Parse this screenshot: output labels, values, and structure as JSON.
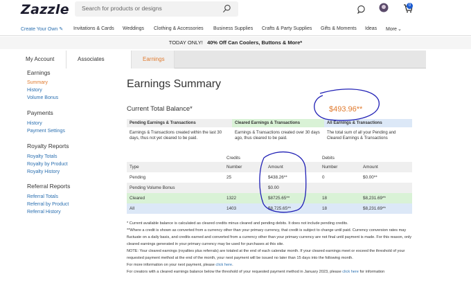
{
  "header": {
    "logo": "Zazzle",
    "search_placeholder": "Search for products or designs",
    "cart_count": "0"
  },
  "nav": {
    "items": [
      "Create Your Own",
      "Invitations & Cards",
      "Weddings",
      "Clothing & Accessories",
      "Business Supplies",
      "Crafts & Party Supplies",
      "Gifts & Moments",
      "Ideas",
      "More"
    ]
  },
  "promo": {
    "prefix": "TODAY ONLY!",
    "text": "40% Off Can Coolers, Buttons & More*"
  },
  "tabs": [
    "My Account",
    "Associates",
    "Earnings"
  ],
  "sidebar": {
    "sections": [
      {
        "title": "Earnings",
        "links": [
          "Summary",
          "History",
          "Volume Bonus"
        ]
      },
      {
        "title": "Payments",
        "links": [
          "History",
          "Payment Settings"
        ]
      },
      {
        "title": "Royalty Reports",
        "links": [
          "Royalty Totals",
          "Royalty by Product",
          "Royalty History"
        ]
      },
      {
        "title": "Referral Reports",
        "links": [
          "Referral Totals",
          "Referral by Product",
          "Referral History"
        ]
      }
    ]
  },
  "main": {
    "title": "Earnings Summary",
    "balance_label": "Current Total Balance*",
    "balance_value": "$493.96**",
    "descriptions": [
      {
        "head": "Pending Earnings & Transactions",
        "body": "Earnings & Transactions created within the last 30 days, thus not yet cleared to be paid."
      },
      {
        "head": "Cleared Earnings & Transactions",
        "body": "Earnings & Transactions created over 30 days ago, thus cleared to be paid."
      },
      {
        "head": "All Earnings & Transactions",
        "body": "The total sum of all your Pending and Cleared Earnings & Transactions"
      }
    ],
    "table": {
      "group_credits": "Credits",
      "group_debits": "Debits",
      "headers": [
        "Type",
        "Number",
        "Amount",
        "Number",
        "Amount"
      ],
      "rows": [
        [
          "Pending",
          "25",
          "$438.26**",
          "0",
          "$0.00**"
        ],
        [
          "Pending Volume Bonus",
          "",
          "$0.00",
          "",
          ""
        ],
        [
          "Cleared",
          "1322",
          "$8725.65**",
          "18",
          "$8,231.69**"
        ],
        [
          "All",
          "1403",
          "$8,725.65**",
          "18",
          "$8,231.69**"
        ]
      ]
    },
    "notes": {
      "n1": "* Current available balance is calculated as cleared credits minus cleared and pending debits. It does not include pending credits.",
      "n2": "**Where a credit is shown as converted from a currency other than your primary currency, that credit is subject to change until paid. Currency conversion rates may fluctuate on a daily basis, and credits earned and converted from a currency other than your primary currency are not final until payment is made. For this reason, only cleared earnings generated in your primary currency may be used for purchases at this site.",
      "n3": "NOTE: Your cleared earnings (royalties plus referrals) are totaled at the end of each calendar month. If your cleared earnings meet or exceed the threshold of your requested payment method at the end of the month, your next payment will be issued no later than 15 days into the following month.",
      "n4_prefix": "For more information on your next payment, please ",
      "n4_link": "click here",
      "n5_prefix": "For creators with a cleared earnings balance below the threshold of your requested payment method in January 2023, please ",
      "n5_link": "click here",
      "n5_suffix": " for information"
    }
  },
  "colors": {
    "accent_orange": "#e07a2e",
    "link_blue": "#2a6fb0",
    "annotation_ink": "#1f1fb5"
  }
}
